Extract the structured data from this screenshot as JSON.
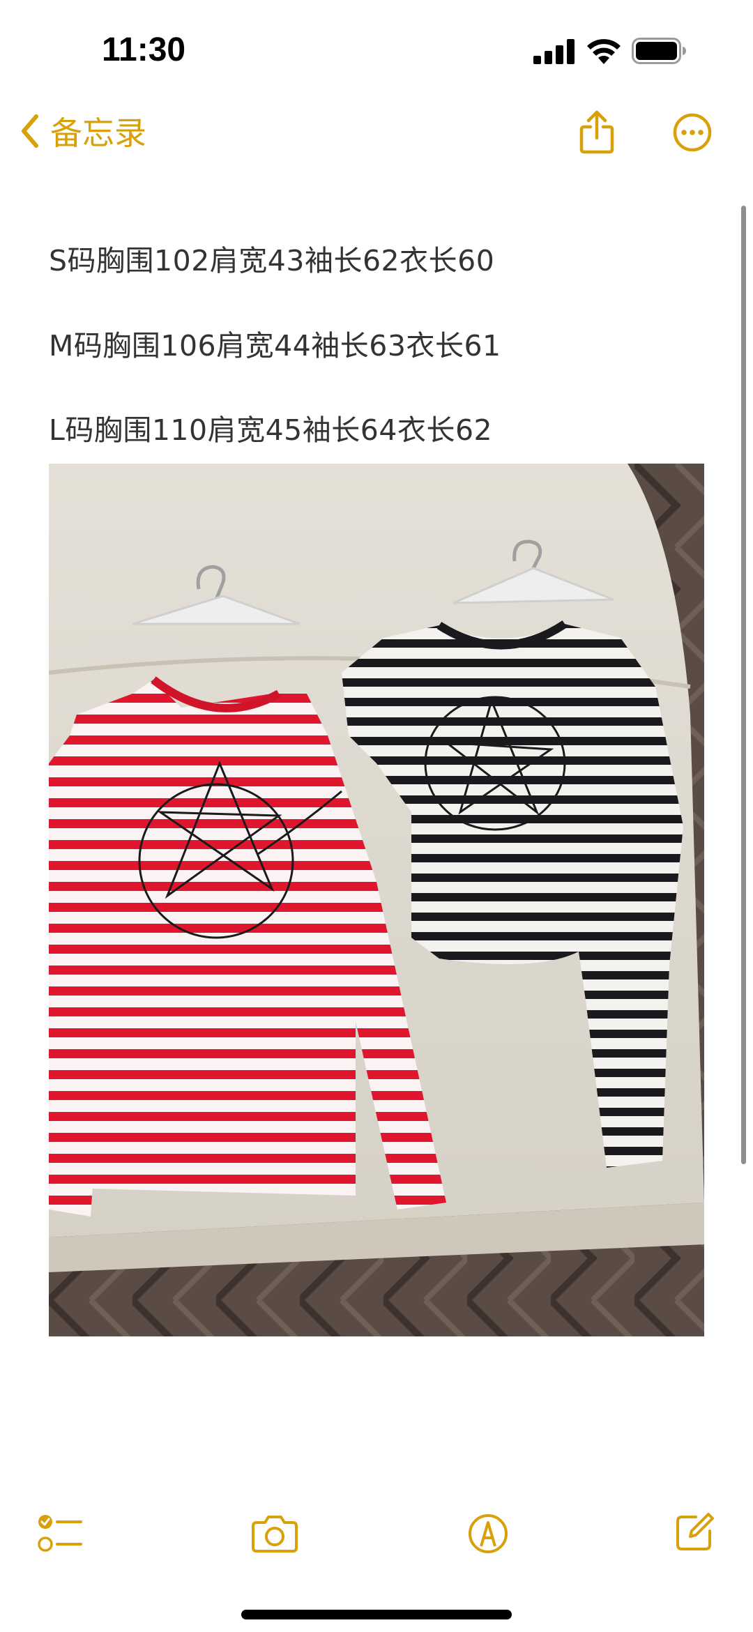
{
  "status_bar": {
    "time": "11:30"
  },
  "nav": {
    "back_label": "备忘录",
    "share_icon": "share-icon",
    "more_icon": "more-icon"
  },
  "note": {
    "lines": [
      "S码胸围102肩宽43袖长62衣长60",
      "M码胸围106肩宽44袖长63衣长61",
      "L码胸围110肩宽45袖长64衣长62"
    ],
    "photo_icon": "photo-two-striped-shirts"
  },
  "toolbar": {
    "checklist_icon": "checklist-icon",
    "camera_icon": "camera-icon",
    "markup_icon": "markup-icon",
    "compose_icon": "compose-icon"
  },
  "colors": {
    "accent": "#d8a10a",
    "text": "#333333",
    "background": "#ffffff"
  }
}
